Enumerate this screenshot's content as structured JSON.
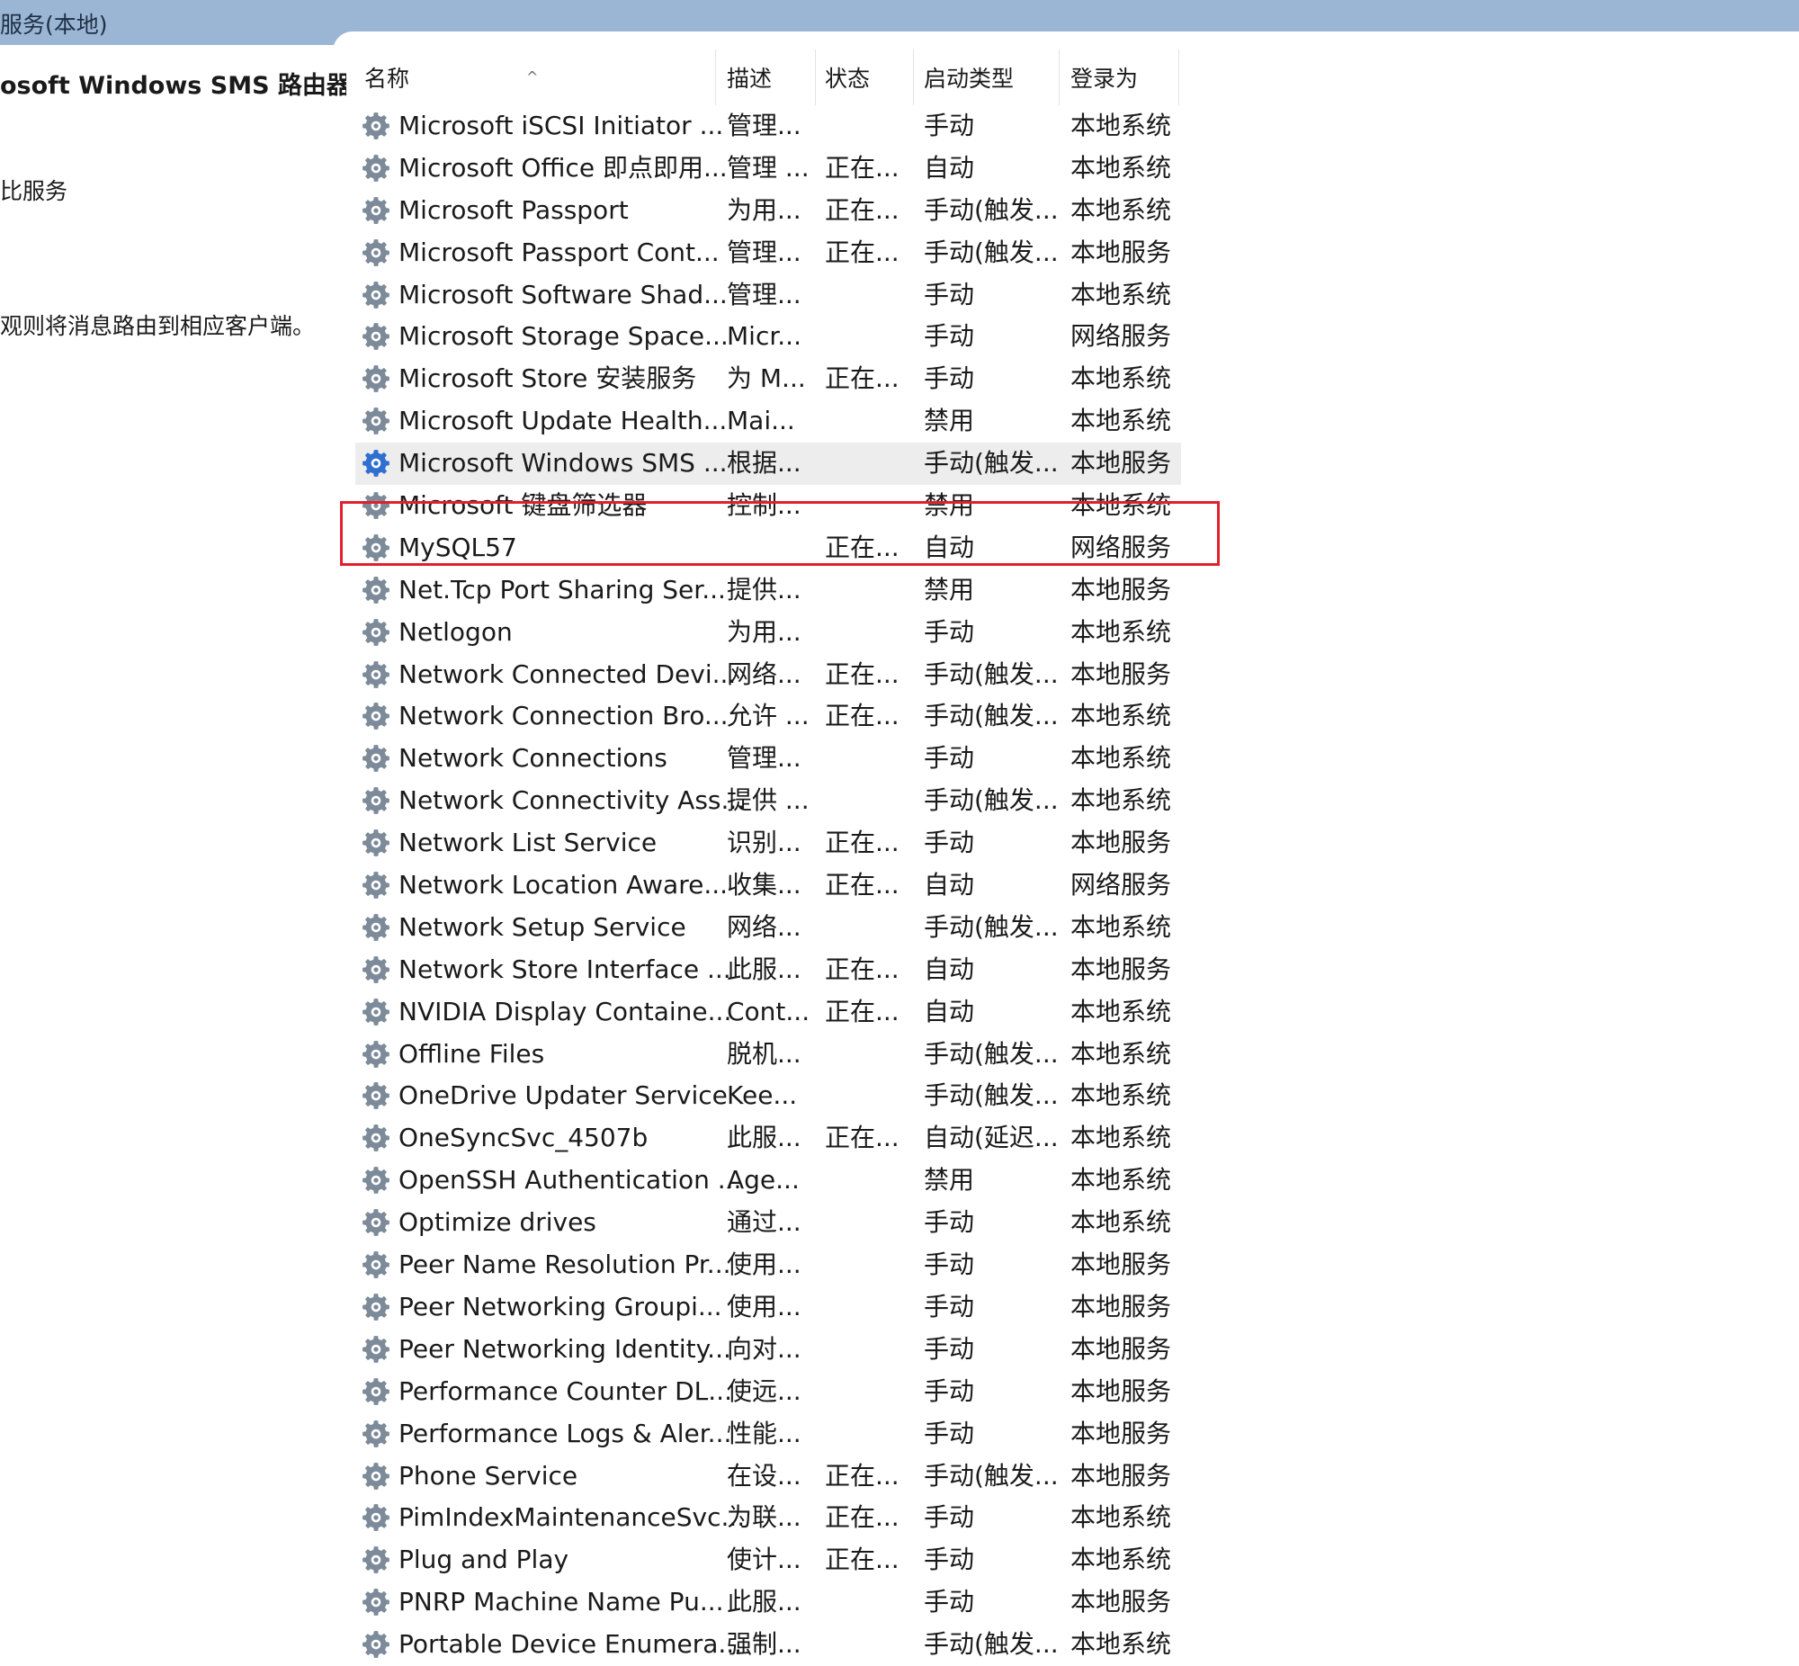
{
  "window": {
    "title": "服务(本地)"
  },
  "left_pane": {
    "service_title": "osoft Windows SMS 路由器服",
    "action_link": "比服务",
    "description": "观则将消息路由到相应客户端。"
  },
  "columns": {
    "name": "名称",
    "description": "描述",
    "status": "状态",
    "startup_type": "启动类型",
    "log_on_as": "登录为"
  },
  "sort_indicator": "^",
  "services": [
    {
      "name": "Microsoft iSCSI Initiator ...",
      "description": "管理...",
      "status": "",
      "startup": "手动",
      "logon": "本地系统"
    },
    {
      "name": "Microsoft Office 即点即用...",
      "description": "管理 ...",
      "status": "正在...",
      "startup": "自动",
      "logon": "本地系统"
    },
    {
      "name": "Microsoft Passport",
      "description": "为用...",
      "status": "正在...",
      "startup": "手动(触发...",
      "logon": "本地系统"
    },
    {
      "name": "Microsoft Passport Cont...",
      "description": "管理...",
      "status": "正在...",
      "startup": "手动(触发...",
      "logon": "本地服务"
    },
    {
      "name": "Microsoft Software Shad...",
      "description": "管理...",
      "status": "",
      "startup": "手动",
      "logon": "本地系统"
    },
    {
      "name": "Microsoft Storage Space...",
      "description": "Micr...",
      "status": "",
      "startup": "手动",
      "logon": "网络服务"
    },
    {
      "name": "Microsoft Store 安装服务",
      "description": "为 M...",
      "status": "正在...",
      "startup": "手动",
      "logon": "本地系统"
    },
    {
      "name": "Microsoft Update Health...",
      "description": "Mai...",
      "status": "",
      "startup": "禁用",
      "logon": "本地系统"
    },
    {
      "name": "Microsoft Windows SMS ...",
      "description": "根据...",
      "status": "",
      "startup": "手动(触发...",
      "logon": "本地服务"
    },
    {
      "name": "Microsoft 键盘筛选器",
      "description": "控制...",
      "status": "",
      "startup": "禁用",
      "logon": "本地系统"
    },
    {
      "name": "MySQL57",
      "description": "",
      "status": "正在...",
      "startup": "自动",
      "logon": "网络服务"
    },
    {
      "name": "Net.Tcp Port Sharing Ser...",
      "description": "提供...",
      "status": "",
      "startup": "禁用",
      "logon": "本地服务"
    },
    {
      "name": "Netlogon",
      "description": "为用...",
      "status": "",
      "startup": "手动",
      "logon": "本地系统"
    },
    {
      "name": "Network Connected Devi...",
      "description": "网络...",
      "status": "正在...",
      "startup": "手动(触发...",
      "logon": "本地服务"
    },
    {
      "name": "Network Connection Bro...",
      "description": "允许 ...",
      "status": "正在...",
      "startup": "手动(触发...",
      "logon": "本地系统"
    },
    {
      "name": "Network Connections",
      "description": "管理...",
      "status": "",
      "startup": "手动",
      "logon": "本地系统"
    },
    {
      "name": "Network Connectivity Ass...",
      "description": "提供 ...",
      "status": "",
      "startup": "手动(触发...",
      "logon": "本地系统"
    },
    {
      "name": "Network List Service",
      "description": "识别...",
      "status": "正在...",
      "startup": "手动",
      "logon": "本地服务"
    },
    {
      "name": "Network Location Aware...",
      "description": "收集...",
      "status": "正在...",
      "startup": "自动",
      "logon": "网络服务"
    },
    {
      "name": "Network Setup Service",
      "description": "网络...",
      "status": "",
      "startup": "手动(触发...",
      "logon": "本地系统"
    },
    {
      "name": "Network Store Interface ...",
      "description": "此服...",
      "status": "正在...",
      "startup": "自动",
      "logon": "本地服务"
    },
    {
      "name": "NVIDIA Display Containe...",
      "description": "Cont...",
      "status": "正在...",
      "startup": "自动",
      "logon": "本地系统"
    },
    {
      "name": "Offline Files",
      "description": "脱机...",
      "status": "",
      "startup": "手动(触发...",
      "logon": "本地系统"
    },
    {
      "name": "OneDrive Updater Service",
      "description": "Kee...",
      "status": "",
      "startup": "手动(触发...",
      "logon": "本地系统"
    },
    {
      "name": "OneSyncSvc_4507b",
      "description": "此服...",
      "status": "正在...",
      "startup": "自动(延迟...",
      "logon": "本地系统"
    },
    {
      "name": "OpenSSH Authentication ...",
      "description": "Age...",
      "status": "",
      "startup": "禁用",
      "logon": "本地系统"
    },
    {
      "name": "Optimize drives",
      "description": "通过...",
      "status": "",
      "startup": "手动",
      "logon": "本地系统"
    },
    {
      "name": "Peer Name Resolution Pr...",
      "description": "使用...",
      "status": "",
      "startup": "手动",
      "logon": "本地服务"
    },
    {
      "name": "Peer Networking Groupi...",
      "description": "使用...",
      "status": "",
      "startup": "手动",
      "logon": "本地服务"
    },
    {
      "name": "Peer Networking Identity...",
      "description": "向对...",
      "status": "",
      "startup": "手动",
      "logon": "本地服务"
    },
    {
      "name": "Performance Counter DL...",
      "description": "使远...",
      "status": "",
      "startup": "手动",
      "logon": "本地服务"
    },
    {
      "name": "Performance Logs & Aler...",
      "description": "性能...",
      "status": "",
      "startup": "手动",
      "logon": "本地服务"
    },
    {
      "name": "Phone Service",
      "description": "在设...",
      "status": "正在...",
      "startup": "手动(触发...",
      "logon": "本地服务"
    },
    {
      "name": "PimIndexMaintenanceSvc...",
      "description": "为联...",
      "status": "正在...",
      "startup": "手动",
      "logon": "本地系统"
    },
    {
      "name": "Plug and Play",
      "description": "使计...",
      "status": "正在...",
      "startup": "手动",
      "logon": "本地系统"
    },
    {
      "name": "PNRP Machine Name Pu...",
      "description": "此服...",
      "status": "",
      "startup": "手动",
      "logon": "本地服务"
    },
    {
      "name": "Portable Device Enumera...",
      "description": "强制...",
      "status": "",
      "startup": "手动(触发...",
      "logon": "本地系统"
    }
  ],
  "selected_index": 8,
  "highlighted_index": 10,
  "colors": {
    "title_bar": "#9bb6d4",
    "selected_row": "#ededed",
    "highlight_box": "#e0202c",
    "gear_icon": "#7c8a99",
    "gear_icon_selected": "#2f6fd0"
  },
  "icons": {
    "service": "gear-icon"
  }
}
